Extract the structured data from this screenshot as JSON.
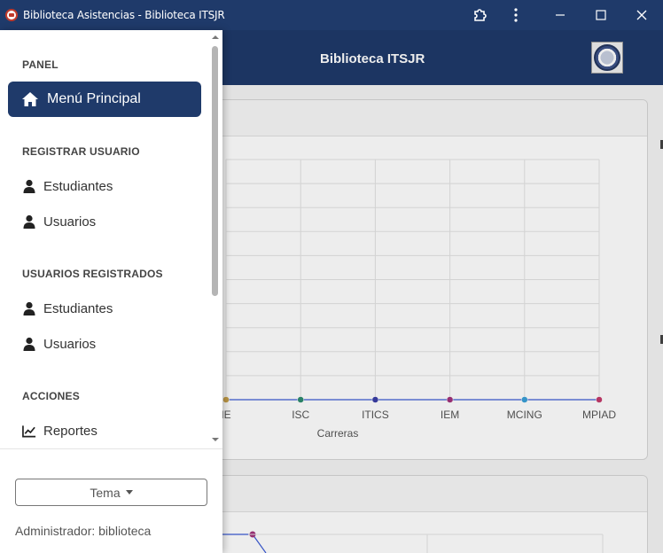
{
  "window": {
    "title": "Biblioteca Asistencias - Biblioteca ITSJR"
  },
  "header": {
    "title": "Biblioteca ITSJR"
  },
  "sidebar": {
    "sections": [
      {
        "title": "PANEL"
      },
      {
        "title": "REGISTRAR USUARIO"
      },
      {
        "title": "USUARIOS REGISTRADOS"
      },
      {
        "title": "ACCIONES"
      }
    ],
    "active_item": "Menú Principal",
    "items": [
      {
        "label": "Estudiantes"
      },
      {
        "label": "Usuarios"
      },
      {
        "label": "Estudiantes"
      },
      {
        "label": "Usuarios"
      },
      {
        "label": "Reportes"
      }
    ],
    "theme_button": "Tema",
    "admin_label": "Administrador: biblioteca"
  },
  "chart_data": {
    "type": "line",
    "x_label": "Carreras",
    "categories": [
      "IE",
      "ISC",
      "ITICS",
      "IEM",
      "MCING",
      "MPIAD"
    ],
    "visible_tick_labels": [
      "IE",
      "ISC",
      "ITICS",
      "IEM",
      "MCING",
      "MPIAD"
    ],
    "values": [
      0,
      0,
      0,
      0,
      0,
      0
    ],
    "point_colors": [
      "#c8a04a",
      "#2e8b6e",
      "#3b3fa6",
      "#a2327a",
      "#3aa0d8",
      "#c43a6a"
    ],
    "line_color": "#3b5bd6",
    "grid": true
  },
  "colors": {
    "primary": "#1f3a6a",
    "active_text": "#ffffff"
  }
}
